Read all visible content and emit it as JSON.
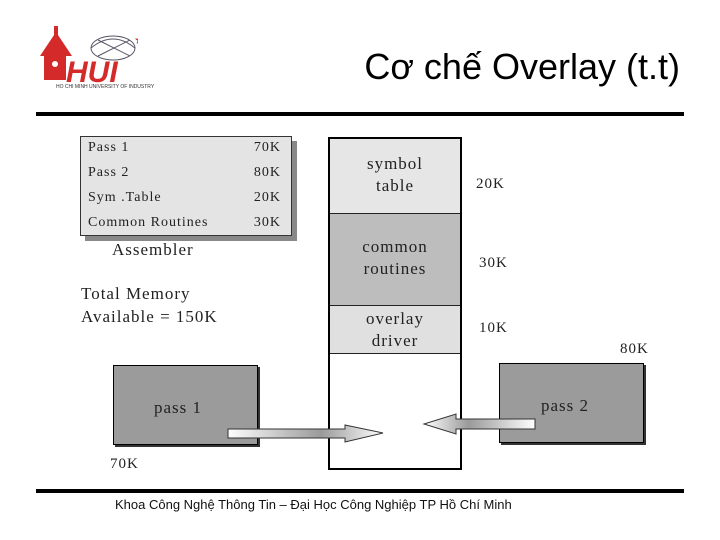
{
  "header": {
    "title": "Cơ chế Overlay (t.t)",
    "logo_text": "HUI",
    "logo_subtext": "HO CHI MINH UNIVERSITY OF INDUSTRY"
  },
  "colors": {
    "logo_red": "#d42a2a",
    "light_segment": "#e6e6e6",
    "dark_segment": "#bdbdbd",
    "pass_box": "#9b9b9b"
  },
  "assembler_table": {
    "rows": [
      {
        "label": "Pass 1",
        "size": "70K"
      },
      {
        "label": "Pass 2",
        "size": "80K"
      },
      {
        "label": "Sym .Table",
        "size": "20K"
      },
      {
        "label": "Common Routines",
        "size": "30K"
      }
    ],
    "caption": "Assembler"
  },
  "total_memory": {
    "line1": "Total Memory",
    "line2": "Available = 150K"
  },
  "memory_column": {
    "segments": [
      {
        "line1": "symbol",
        "line2": "table",
        "size": "20K"
      },
      {
        "line1": "common",
        "line2": "routines",
        "size": "30K"
      },
      {
        "line1": "overlay",
        "line2": "driver",
        "size": "10K"
      }
    ]
  },
  "passes": {
    "pass1": {
      "label": "pass 1",
      "size": "70K"
    },
    "pass2": {
      "label": "pass 2",
      "size": "80K"
    }
  },
  "footer": {
    "text": "Khoa Công Nghệ Thông Tin – Đại Học Công Nghiệp TP Hồ Chí Minh"
  }
}
